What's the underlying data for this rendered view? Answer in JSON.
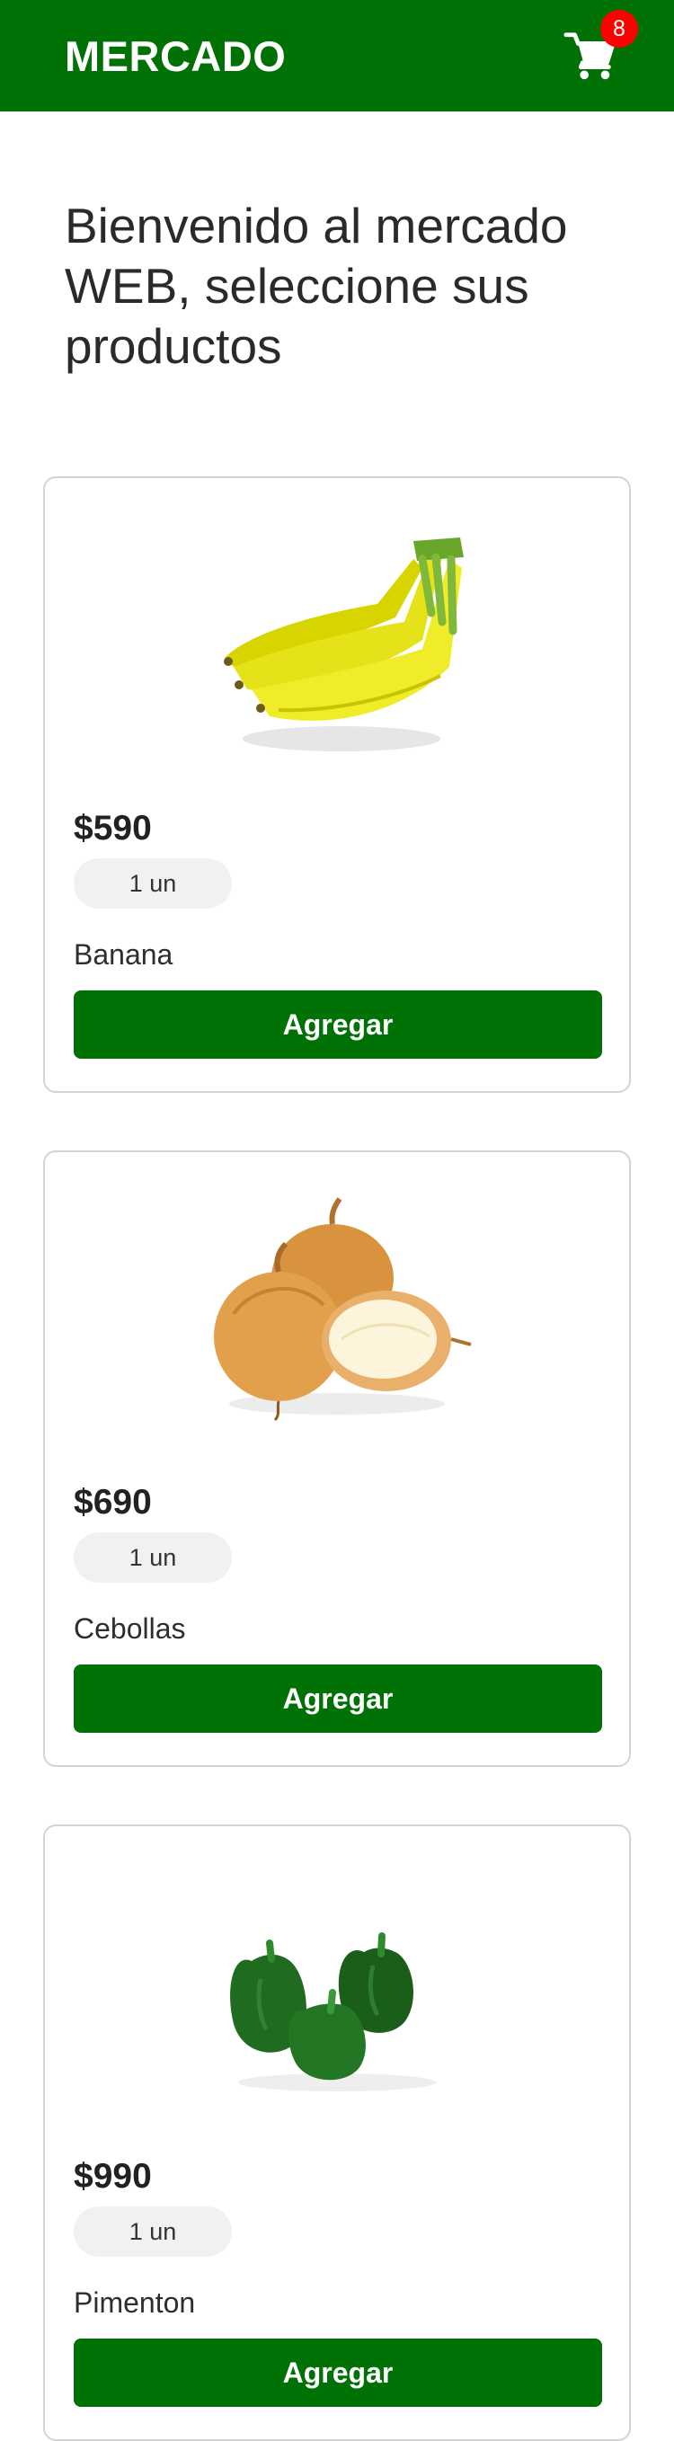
{
  "header": {
    "brand": "MERCADO",
    "cart_count": "8",
    "cart_icon": "shopping-cart-icon"
  },
  "main": {
    "title": "Bienvenido al mercado WEB, seleccione sus productos"
  },
  "products": [
    {
      "name": "Banana",
      "price": "$590",
      "quantity": "1 un",
      "button_label": "Agregar",
      "image": "banana-image"
    },
    {
      "name": "Cebollas",
      "price": "$690",
      "quantity": "1 un",
      "button_label": "Agregar",
      "image": "onion-image"
    },
    {
      "name": "Pimenton",
      "price": "$990",
      "quantity": "1 un",
      "button_label": "Agregar",
      "image": "green-pepper-image"
    }
  ],
  "colors": {
    "brand_green": "#007205",
    "badge_red": "#ff0000",
    "card_border": "#d4d4d4"
  }
}
